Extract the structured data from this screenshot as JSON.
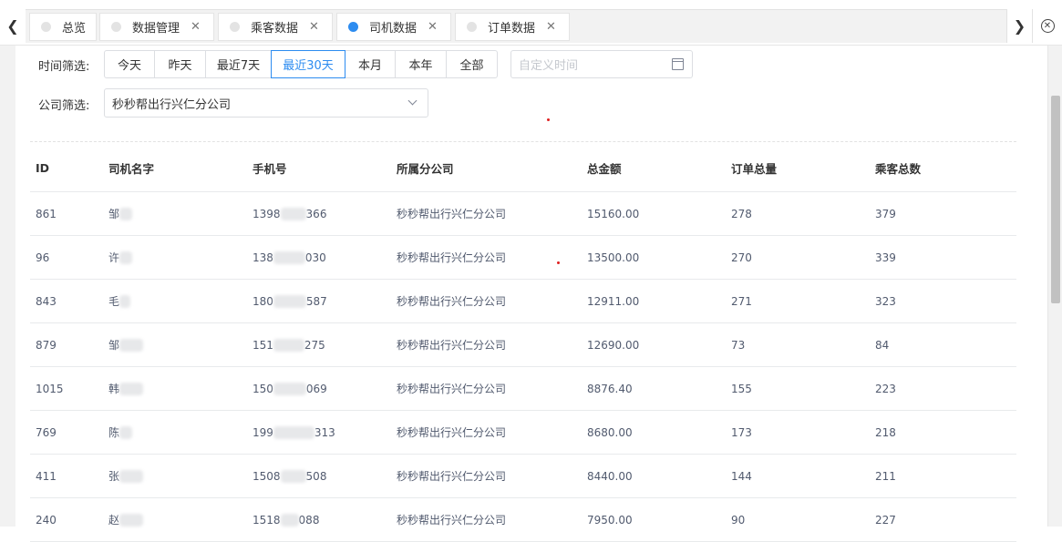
{
  "tabs": [
    {
      "label": "总览",
      "closable": false,
      "active": false
    },
    {
      "label": "数据管理",
      "closable": true,
      "active": false
    },
    {
      "label": "乘客数据",
      "closable": true,
      "active": false
    },
    {
      "label": "司机数据",
      "closable": true,
      "active": true
    },
    {
      "label": "订单数据",
      "closable": true,
      "active": false
    }
  ],
  "filters": {
    "time_label": "时间筛选:",
    "time_options": [
      "今天",
      "昨天",
      "最近7天",
      "最近30天",
      "本月",
      "本年",
      "全部"
    ],
    "time_selected": "最近30天",
    "date_placeholder": "自定义时间",
    "company_label": "公司筛选:",
    "company_value": "秒秒帮出行兴仁分公司"
  },
  "table": {
    "headers": [
      "ID",
      "司机名字",
      "手机号",
      "所属分公司",
      "总金额",
      "订单总量",
      "乘客总数"
    ],
    "rows": [
      {
        "id": "861",
        "name": "邹",
        "phone_start": "1398",
        "phone_end": "366",
        "company": "秒秒帮出行兴仁分公司",
        "amount": "15160.00",
        "orders": "278",
        "passengers": "379"
      },
      {
        "id": "96",
        "name": "许",
        "phone_start": "138",
        "phone_end": "030",
        "company": "秒秒帮出行兴仁分公司",
        "amount": "13500.00",
        "orders": "270",
        "passengers": "339"
      },
      {
        "id": "843",
        "name": "毛",
        "phone_start": "180",
        "phone_end": "587",
        "company": "秒秒帮出行兴仁分公司",
        "amount": "12911.00",
        "orders": "271",
        "passengers": "323"
      },
      {
        "id": "879",
        "name": "邹",
        "phone_start": "151",
        "phone_end": "275",
        "company": "秒秒帮出行兴仁分公司",
        "amount": "12690.00",
        "orders": "73",
        "passengers": "84"
      },
      {
        "id": "1015",
        "name": "韩",
        "phone_start": "150",
        "phone_end": "069",
        "company": "秒秒帮出行兴仁分公司",
        "amount": "8876.40",
        "orders": "155",
        "passengers": "223"
      },
      {
        "id": "769",
        "name": "陈",
        "phone_start": "199",
        "phone_end": "313",
        "company": "秒秒帮出行兴仁分公司",
        "amount": "8680.00",
        "orders": "173",
        "passengers": "218"
      },
      {
        "id": "411",
        "name": "张",
        "phone_start": "1508",
        "phone_end": "508",
        "company": "秒秒帮出行兴仁分公司",
        "amount": "8440.00",
        "orders": "144",
        "passengers": "211"
      },
      {
        "id": "240",
        "name": "赵",
        "phone_start": "1518",
        "phone_end": "088",
        "company": "秒秒帮出行兴仁分公司",
        "amount": "7950.00",
        "orders": "90",
        "passengers": "227"
      }
    ]
  },
  "icons": {
    "prev": "chevron-left-icon",
    "next": "chevron-right-icon",
    "close_all": "close-circle-icon",
    "calendar": "calendar-icon",
    "dropdown": "chevron-down-icon"
  },
  "colors": {
    "accent": "#2d8cf0",
    "dot_inactive": "#e3e3e3",
    "marker": "#e02020"
  }
}
